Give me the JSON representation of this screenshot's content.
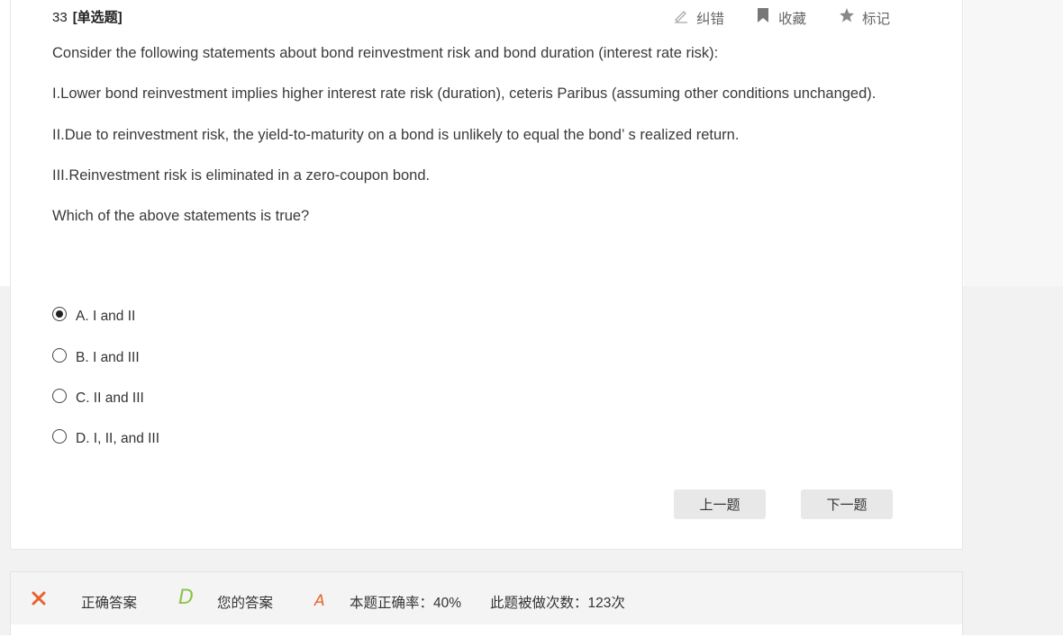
{
  "question": {
    "number": "33",
    "type_label": "[单选题]",
    "lines": [
      "Consider the following statements about bond reinvestment risk and bond duration (interest rate risk):",
      "I.Lower bond reinvestment implies higher interest rate risk (duration), ceteris Paribus (assuming other conditions unchanged).",
      "II.Due to reinvestment risk, the yield-to-maturity on a bond is unlikely to equal the bond’ s realized return.",
      "III.Reinvestment risk is eliminated in a zero-coupon bond.",
      "Which of the above statements is true?"
    ]
  },
  "toolbar": {
    "report_label": "纠错",
    "favorite_label": "收藏",
    "mark_label": "标记"
  },
  "options": [
    {
      "label": "A. I and II",
      "selected": true
    },
    {
      "label": "B. I and III",
      "selected": false
    },
    {
      "label": "C. II and III",
      "selected": false
    },
    {
      "label": "D. I, II, and III",
      "selected": false
    }
  ],
  "nav": {
    "prev_label": "上一题",
    "next_label": "下一题"
  },
  "result": {
    "status_icon": "cross-icon",
    "correct_answer_letter": "D",
    "correct_answer_label": "正确答案",
    "your_answer_letter": "A",
    "your_answer_label": "您的答案",
    "accuracy_text": "本题正确率：40%",
    "attempts_text": "此题被做次数：123次"
  },
  "colors": {
    "correct_letter": "#8bc34a",
    "your_letter": "#e8632c",
    "wrong_mark": "#e8632c",
    "button_bg": "#e8e8e8",
    "page_bg": "#f2f2f2"
  }
}
